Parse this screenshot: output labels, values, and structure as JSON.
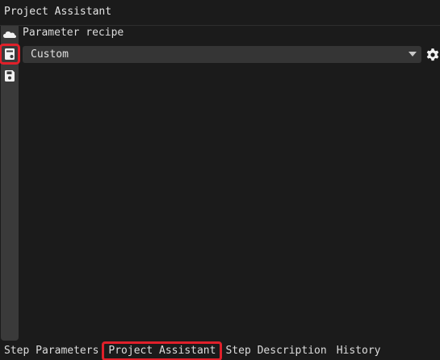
{
  "window": {
    "title": "Project Assistant"
  },
  "sidebar": {
    "icons": [
      {
        "name": "cloud-icon",
        "highlighted": false
      },
      {
        "name": "recipe-book-icon",
        "highlighted": true
      },
      {
        "name": "save-icon",
        "highlighted": false
      }
    ]
  },
  "main": {
    "section_label": "Parameter recipe",
    "recipe_select": {
      "value": "Custom"
    }
  },
  "tabs": [
    {
      "label": "Step Parameters",
      "active": false
    },
    {
      "label": "Project Assistant",
      "active": true
    },
    {
      "label": "Step Description",
      "active": false
    },
    {
      "label": "History",
      "active": false
    }
  ],
  "colors": {
    "background": "#1b1b1b",
    "sidebar": "#3a3a3a",
    "dropdown": "#353535",
    "highlight": "#e0202a",
    "text": "#dcdcdc"
  }
}
